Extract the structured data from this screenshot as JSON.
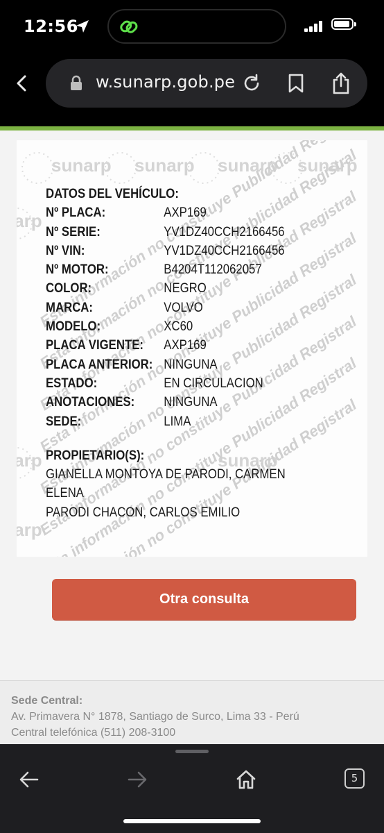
{
  "status_bar": {
    "time": "12:56"
  },
  "browser": {
    "url": "w.sunarp.gob.pe"
  },
  "watermark": {
    "brand": "sunarp",
    "diagonal_text": "Esta información no constituye Publicidad Registral"
  },
  "vehicle": {
    "heading": "DATOS DEL VEHÍCULO:",
    "fields": [
      {
        "label": "Nº PLACA:",
        "value": "AXP169"
      },
      {
        "label": "Nº SERIE:",
        "value": "YV1DZ40CCH2166456"
      },
      {
        "label": "Nº VIN:",
        "value": "YV1DZ40CCH2166456"
      },
      {
        "label": "Nº MOTOR:",
        "value": "B4204T112062057"
      },
      {
        "label": "COLOR:",
        "value": "NEGRO"
      },
      {
        "label": "MARCA:",
        "value": "VOLVO"
      },
      {
        "label": "MODELO:",
        "value": "XC60"
      },
      {
        "label": "PLACA VIGENTE:",
        "value": "AXP169"
      },
      {
        "label": "PLACA ANTERIOR:",
        "value": "NINGUNA"
      },
      {
        "label": "ESTADO:",
        "value": "EN CIRCULACION"
      },
      {
        "label": "ANOTACIONES:",
        "value": "NINGUNA"
      },
      {
        "label": "SEDE:",
        "value": "LIMA"
      }
    ],
    "owners_heading": "PROPIETARIO(S):",
    "owners": [
      "GIANELLA MONTOYA DE PARODI, CARMEN ELENA",
      "PARODI CHACON, CARLOS EMILIO"
    ]
  },
  "cta": {
    "label": "Otra consulta"
  },
  "footer": {
    "title": "Sede Central:",
    "address": "Av. Primavera N° 1878, Santiago de Surco, Lima 33 - Perú",
    "phone": "Central telefónica (511) 208-3100"
  },
  "toolbar": {
    "tab_count": "5"
  },
  "colors": {
    "accent_green": "#7cb342",
    "cta_red": "#d05a43"
  }
}
